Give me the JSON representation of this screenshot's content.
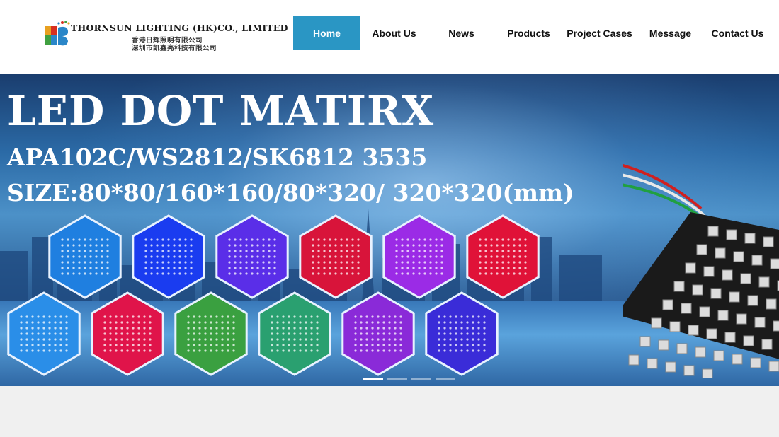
{
  "logo": {
    "name_en": "THORNSUN LIGHTING (HK)CO., LIMITED",
    "name_cn_1": "香港日辉照明有限公司",
    "name_cn_2": "深圳市凯鑫亮科技有限公司",
    "icon": "ts-logo-icon"
  },
  "nav": {
    "items": [
      {
        "label": "Home",
        "active": true
      },
      {
        "label": "About Us",
        "active": false
      },
      {
        "label": "News",
        "active": false
      },
      {
        "label": "Products",
        "active": false
      },
      {
        "label": "Project Cases",
        "active": false
      },
      {
        "label": "Message",
        "active": false
      },
      {
        "label": "Contact Us",
        "active": false
      }
    ],
    "active_color": "#2a96c4"
  },
  "banner": {
    "title": "LED DOT MATIRX",
    "subtitle_1": "APA102C/WS2812/SK6812 3535",
    "subtitle_2": "SIZE:80*80/160*160/80*320/ 320*320(mm)",
    "hex_colors_top": [
      "#1f7fe0",
      "#1a3cf0",
      "#5a2ee8",
      "#d8143a",
      "#9b2be6",
      "#e01238"
    ],
    "hex_colors_bottom": [
      "#2a8ee8",
      "#e0144a",
      "#3aa040",
      "#2aa070",
      "#8a2ad8",
      "#3a2cd8"
    ],
    "slides": 4,
    "active_slide": 0
  }
}
